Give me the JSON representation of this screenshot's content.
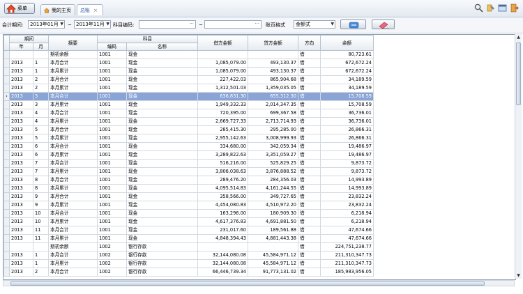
{
  "topbar": {
    "menu_label": "菜单",
    "tabs": [
      {
        "label": "我的主页"
      },
      {
        "label": "总账",
        "close": "×"
      }
    ]
  },
  "filter": {
    "period_label": "会计期间:",
    "period_from": "2013年01月",
    "tilde1": "~",
    "period_to": "2013年11月",
    "account_code_label": "科目编码:",
    "account_from": "",
    "tilde2": "~",
    "account_to": "",
    "format_label": "账页格式",
    "format_value": "金额式"
  },
  "table": {
    "headers": {
      "period": "期间",
      "year": "年",
      "month": "月",
      "summary": "摘要",
      "account": "科目",
      "code": "编码",
      "name": "名称",
      "debit": "借方金额",
      "credit": "贷方金额",
      "direction": "方向",
      "balance": "余额"
    },
    "rows": [
      {
        "year": "",
        "month": "",
        "summary": "期初余额",
        "code": "1001",
        "name": "现金",
        "debit": "",
        "credit": "",
        "dir": "借",
        "balance": "80,723.61"
      },
      {
        "year": "2013",
        "month": "1",
        "summary": "本月合计",
        "code": "1001",
        "name": "现金",
        "debit": "1,085,079.00",
        "credit": "493,130.37",
        "dir": "借",
        "balance": "672,672.24"
      },
      {
        "year": "2013",
        "month": "1",
        "summary": "本月累计",
        "code": "1001",
        "name": "现金",
        "debit": "1,085,079.00",
        "credit": "493,130.37",
        "dir": "借",
        "balance": "672,672.24"
      },
      {
        "year": "2013",
        "month": "2",
        "summary": "本月合计",
        "code": "1001",
        "name": "现金",
        "debit": "227,422.03",
        "credit": "865,904.68",
        "dir": "借",
        "balance": "34,189.59"
      },
      {
        "year": "2013",
        "month": "2",
        "summary": "本月累计",
        "code": "1001",
        "name": "现金",
        "debit": "1,312,501.03",
        "credit": "1,359,035.05",
        "dir": "借",
        "balance": "34,189.59"
      },
      {
        "year": "2013",
        "month": "3",
        "summary": "本月合计",
        "code": "1001",
        "name": "现金",
        "debit": "636,831.30",
        "credit": "655,312.30",
        "dir": "借",
        "balance": "15,708.59",
        "selected": true
      },
      {
        "year": "2013",
        "month": "3",
        "summary": "本月累计",
        "code": "1001",
        "name": "现金",
        "debit": "1,949,332.33",
        "credit": "2,014,347.35",
        "dir": "借",
        "balance": "15,708.59"
      },
      {
        "year": "2013",
        "month": "4",
        "summary": "本月合计",
        "code": "1001",
        "name": "现金",
        "debit": "720,395.00",
        "credit": "699,367.58",
        "dir": "借",
        "balance": "36,736.01"
      },
      {
        "year": "2013",
        "month": "4",
        "summary": "本月累计",
        "code": "1001",
        "name": "现金",
        "debit": "2,669,727.33",
        "credit": "2,713,714.93",
        "dir": "借",
        "balance": "36,736.01"
      },
      {
        "year": "2013",
        "month": "5",
        "summary": "本月合计",
        "code": "1001",
        "name": "现金",
        "debit": "285,415.30",
        "credit": "295,285.00",
        "dir": "借",
        "balance": "26,866.31"
      },
      {
        "year": "2013",
        "month": "5",
        "summary": "本月累计",
        "code": "1001",
        "name": "现金",
        "debit": "2,955,142.63",
        "credit": "3,008,999.93",
        "dir": "借",
        "balance": "26,866.31"
      },
      {
        "year": "2013",
        "month": "6",
        "summary": "本月合计",
        "code": "1001",
        "name": "现金",
        "debit": "334,680.00",
        "credit": "342,059.34",
        "dir": "借",
        "balance": "19,486.97"
      },
      {
        "year": "2013",
        "month": "6",
        "summary": "本月累计",
        "code": "1001",
        "name": "现金",
        "debit": "3,289,822.63",
        "credit": "3,351,059.27",
        "dir": "借",
        "balance": "19,486.97"
      },
      {
        "year": "2013",
        "month": "7",
        "summary": "本月合计",
        "code": "1001",
        "name": "现金",
        "debit": "516,216.00",
        "credit": "525,829.25",
        "dir": "借",
        "balance": "9,873.72"
      },
      {
        "year": "2013",
        "month": "7",
        "summary": "本月累计",
        "code": "1001",
        "name": "现金",
        "debit": "3,806,038.63",
        "credit": "3,876,888.52",
        "dir": "借",
        "balance": "9,873.72"
      },
      {
        "year": "2013",
        "month": "8",
        "summary": "本月合计",
        "code": "1001",
        "name": "现金",
        "debit": "289,476.20",
        "credit": "284,356.03",
        "dir": "借",
        "balance": "14,993.89"
      },
      {
        "year": "2013",
        "month": "8",
        "summary": "本月累计",
        "code": "1001",
        "name": "现金",
        "debit": "4,095,514.83",
        "credit": "4,161,244.55",
        "dir": "借",
        "balance": "14,993.89"
      },
      {
        "year": "2013",
        "month": "9",
        "summary": "本月合计",
        "code": "1001",
        "name": "现金",
        "debit": "358,566.00",
        "credit": "349,727.65",
        "dir": "借",
        "balance": "23,832.24"
      },
      {
        "year": "2013",
        "month": "9",
        "summary": "本月累计",
        "code": "1001",
        "name": "现金",
        "debit": "4,454,080.83",
        "credit": "4,510,972.20",
        "dir": "借",
        "balance": "23,832.24"
      },
      {
        "year": "2013",
        "month": "10",
        "summary": "本月合计",
        "code": "1001",
        "name": "现金",
        "debit": "163,296.00",
        "credit": "180,909.30",
        "dir": "借",
        "balance": "6,218.94"
      },
      {
        "year": "2013",
        "month": "10",
        "summary": "本月累计",
        "code": "1001",
        "name": "现金",
        "debit": "4,617,376.83",
        "credit": "4,691,881.50",
        "dir": "借",
        "balance": "6,218.94"
      },
      {
        "year": "2013",
        "month": "11",
        "summary": "本月合计",
        "code": "1001",
        "name": "现金",
        "debit": "231,017.60",
        "credit": "189,561.88",
        "dir": "借",
        "balance": "47,674.66"
      },
      {
        "year": "2013",
        "month": "11",
        "summary": "本月累计",
        "code": "1001",
        "name": "现金",
        "debit": "4,848,394.43",
        "credit": "4,881,443.38",
        "dir": "借",
        "balance": "47,674.66"
      },
      {
        "year": "",
        "month": "",
        "summary": "期初余额",
        "code": "1002",
        "name": "银行存款",
        "debit": "",
        "credit": "",
        "dir": "借",
        "balance": "224,751,238.77"
      },
      {
        "year": "2013",
        "month": "1",
        "summary": "本月合计",
        "code": "1002",
        "name": "银行存款",
        "debit": "32,144,080.08",
        "credit": "45,584,971.12",
        "dir": "借",
        "balance": "211,310,347.73"
      },
      {
        "year": "2013",
        "month": "1",
        "summary": "本月累计",
        "code": "1002",
        "name": "银行存款",
        "debit": "32,144,080.08",
        "credit": "45,584,971.12",
        "dir": "借",
        "balance": "211,310,347.73"
      },
      {
        "year": "2013",
        "month": "2",
        "summary": "本月合计",
        "code": "1002",
        "name": "银行存款",
        "debit": "66,446,739.34",
        "credit": "91,773,131.02",
        "dir": "借",
        "balance": "185,983,956.05"
      }
    ]
  },
  "icons": {
    "search": "search-icon",
    "tools": "tools-icon",
    "window": "window-icon",
    "exit": "exit-icon",
    "query": "query-icon",
    "clear": "eraser-icon"
  }
}
